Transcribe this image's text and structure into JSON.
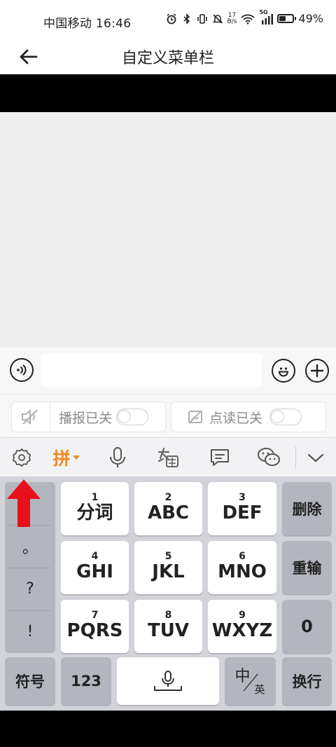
{
  "status_bar": {
    "carrier_time": "中国移动 16:46",
    "net_speed_value": "17",
    "net_speed_unit": "B/s",
    "signal_tag": "5G",
    "battery": "49%",
    "battery_level": 0.49
  },
  "nav": {
    "title": "自定义菜单栏"
  },
  "input_row": {
    "text_value": ""
  },
  "toggles": {
    "broadcast_label": "播报已关",
    "broadcast_on": false,
    "read_label": "点读已关",
    "read_on": false
  },
  "ime_toolbar": {
    "pinyin_label": "拼"
  },
  "keyboard": {
    "row1": [
      {
        "num": "1",
        "label": "分词"
      },
      {
        "num": "2",
        "label": "ABC"
      },
      {
        "num": "3",
        "label": "DEF"
      }
    ],
    "row2": [
      {
        "num": "4",
        "label": "GHI"
      },
      {
        "num": "5",
        "label": "JKL"
      },
      {
        "num": "6",
        "label": "MNO"
      }
    ],
    "row3": [
      {
        "num": "7",
        "label": "PQRS"
      },
      {
        "num": "8",
        "label": "TUV"
      },
      {
        "num": "9",
        "label": "WXYZ"
      }
    ],
    "punct": [
      "。",
      "?",
      "!"
    ],
    "delete_label": "删除",
    "retype_label": "重输",
    "zero_label": "0",
    "symbol_label": "符号",
    "num_label": "123",
    "zh_label": "中",
    "en_label": "英",
    "enter_label": "换行"
  },
  "colors": {
    "accent_orange": "#f08a24",
    "annotation_red": "#e8101c"
  }
}
